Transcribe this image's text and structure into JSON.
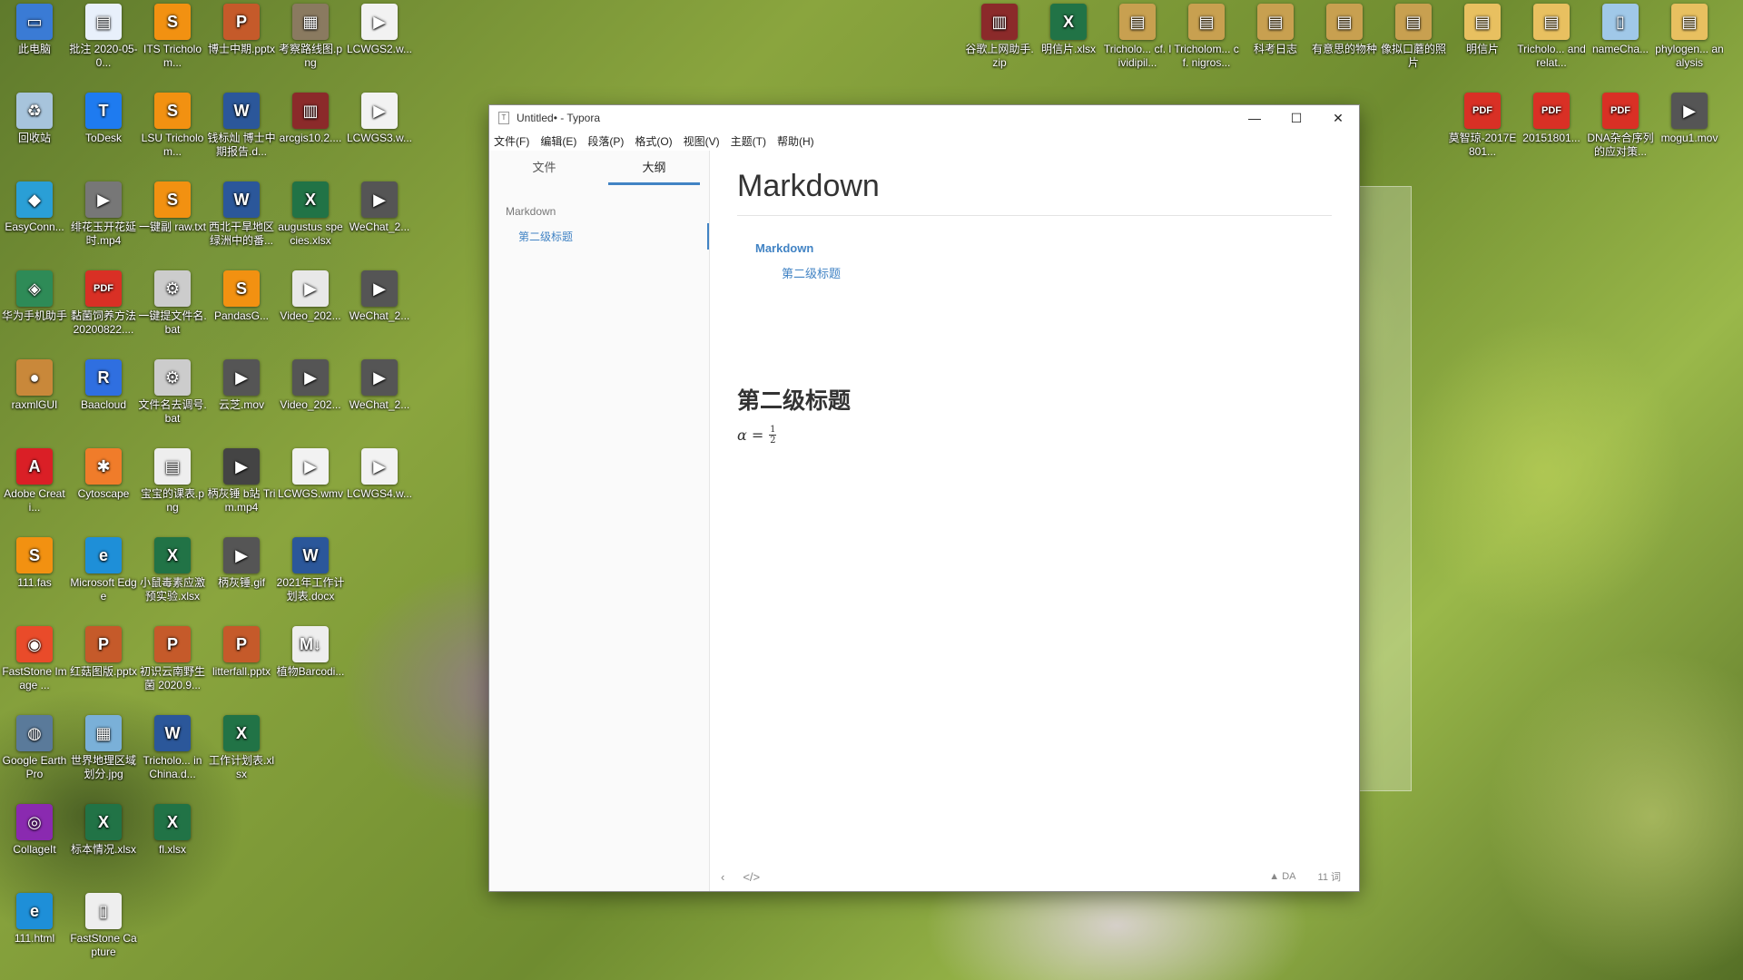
{
  "desktop": {
    "icons": [
      {
        "label": "此电脑",
        "glyph": "▭",
        "color": "#3a7bd5"
      },
      {
        "label": "批注 2020-05-0...",
        "glyph": "▤",
        "color": "#e8f0fb"
      },
      {
        "label": "ITS Tricholom...",
        "glyph": "S",
        "color": "#f29111"
      },
      {
        "label": "博士中期.pptx",
        "glyph": "P",
        "color": "#c55a2a"
      },
      {
        "label": "考察路线图.png",
        "glyph": "▦",
        "color": "#8a7a60"
      },
      {
        "label": "LCWGS2.w...",
        "glyph": "▶",
        "color": "#f2f2f2"
      },
      {
        "label": "回收站",
        "glyph": "♻",
        "color": "#a7c4dc"
      },
      {
        "label": "ToDesk",
        "glyph": "T",
        "color": "#1e7bf0"
      },
      {
        "label": "LSU Tricholom...",
        "glyph": "S",
        "color": "#f29111"
      },
      {
        "label": "钱标灿 博士中期报告.d...",
        "glyph": "W",
        "color": "#2b579a"
      },
      {
        "label": "arcgis10.2....",
        "glyph": "▥",
        "color": "#8b2a2a"
      },
      {
        "label": "LCWGS3.w...",
        "glyph": "▶",
        "color": "#f2f2f2"
      },
      {
        "label": "EasyConn...",
        "glyph": "◆",
        "color": "#2a9fd6"
      },
      {
        "label": "绯花玉开花延时.mp4",
        "glyph": "▶",
        "color": "#777"
      },
      {
        "label": "一键副 raw.txt",
        "glyph": "S",
        "color": "#f29111"
      },
      {
        "label": "西北干旱地区绿洲中的番...",
        "glyph": "W",
        "color": "#2b579a"
      },
      {
        "label": "augustus species.xlsx",
        "glyph": "X",
        "color": "#217346"
      },
      {
        "label": "WeChat_2...",
        "glyph": "▶",
        "color": "#555"
      },
      {
        "label": "华为手机助手",
        "glyph": "◈",
        "color": "#2e8b57"
      },
      {
        "label": "黏菌饲养方法20200822....",
        "glyph": "PDF",
        "color": "#d93025"
      },
      {
        "label": "一键提文件名.bat",
        "glyph": "⚙",
        "color": "#ccc"
      },
      {
        "label": "PandasG...",
        "glyph": "S",
        "color": "#f29111"
      },
      {
        "label": "Video_202...",
        "glyph": "▶",
        "color": "#e8e8e8"
      },
      {
        "label": "WeChat_2...",
        "glyph": "▶",
        "color": "#555"
      },
      {
        "label": "raxmlGUI",
        "glyph": "●",
        "color": "#c9883a"
      },
      {
        "label": "Baacloud",
        "glyph": "R",
        "color": "#2f6fe0"
      },
      {
        "label": "文件名去调号.bat",
        "glyph": "⚙",
        "color": "#ccc"
      },
      {
        "label": "云芝.mov",
        "glyph": "▶",
        "color": "#555"
      },
      {
        "label": "Video_202...",
        "glyph": "▶",
        "color": "#555"
      },
      {
        "label": "WeChat_2...",
        "glyph": "▶",
        "color": "#555"
      },
      {
        "label": "Adobe Creati...",
        "glyph": "A",
        "color": "#da1f26"
      },
      {
        "label": "Cytoscape",
        "glyph": "✱",
        "color": "#f07c2a"
      },
      {
        "label": "宝宝的课表.png",
        "glyph": "▤",
        "color": "#eee"
      },
      {
        "label": "柄灰锤 b站 Trim.mp4",
        "glyph": "▶",
        "color": "#444"
      },
      {
        "label": "LCWGS.wmv",
        "glyph": "▶",
        "color": "#f2f2f2"
      },
      {
        "label": "LCWGS4.w...",
        "glyph": "▶",
        "color": "#f2f2f2"
      },
      {
        "label": "111.fas",
        "glyph": "S",
        "color": "#f29111"
      },
      {
        "label": "Microsoft Edge",
        "glyph": "e",
        "color": "#1e8fd8"
      },
      {
        "label": "小鼠毒素应激预实验.xlsx",
        "glyph": "X",
        "color": "#217346"
      },
      {
        "label": "柄灰锤.gif",
        "glyph": "▶",
        "color": "#555"
      },
      {
        "label": "2021年工作计划表.docx",
        "glyph": "W",
        "color": "#2b579a"
      },
      {
        "label": "FastStone Image ...",
        "glyph": "◉",
        "color": "#e94b2a"
      },
      {
        "label": "红菇图版.pptx",
        "glyph": "P",
        "color": "#c55a2a"
      },
      {
        "label": "初识云南野生菌 2020.9...",
        "glyph": "P",
        "color": "#c55a2a"
      },
      {
        "label": "litterfall.pptx",
        "glyph": "P",
        "color": "#c55a2a"
      },
      {
        "label": "植物Barcodi...",
        "glyph": "M↓",
        "color": "#eee"
      },
      {
        "label": "Google Earth Pro",
        "glyph": "◍",
        "color": "#5a7a9a"
      },
      {
        "label": "世界地理区域划分.jpg",
        "glyph": "▦",
        "color": "#7ab0d8"
      },
      {
        "label": "Tricholo... in China.d...",
        "glyph": "W",
        "color": "#2b579a"
      },
      {
        "label": "工作计划表.xlsx",
        "glyph": "X",
        "color": "#217346"
      },
      {
        "label": "CollageIt",
        "glyph": "◎",
        "color": "#8a2ab0"
      },
      {
        "label": "标本情况.xlsx",
        "glyph": "X",
        "color": "#217346"
      },
      {
        "label": "fl.xlsx",
        "glyph": "X",
        "color": "#217346"
      },
      {
        "label": "111.html",
        "glyph": "e",
        "color": "#1e8fd8"
      },
      {
        "label": "FastStone Capture",
        "glyph": "▯",
        "color": "#eee"
      }
    ],
    "right_icons": [
      {
        "label": "谷歌上网助手.zip",
        "glyph": "▥",
        "color": "#8b2a2a"
      },
      {
        "label": "明信片.xlsx",
        "glyph": "X",
        "color": "#217346"
      },
      {
        "label": "Tricholo... cf. lividipil...",
        "glyph": "▤",
        "color": "#c8a050"
      },
      {
        "label": "Tricholom... cf. nigros...",
        "glyph": "▤",
        "color": "#c8a050"
      },
      {
        "label": "科考日志",
        "glyph": "▤",
        "color": "#c8a050"
      },
      {
        "label": "有意思的物种",
        "glyph": "▤",
        "color": "#c8a050"
      },
      {
        "label": "像拟口蘑的照片",
        "glyph": "▤",
        "color": "#c8a050"
      },
      {
        "label": "明信片",
        "glyph": "▤",
        "color": "#e8c060"
      },
      {
        "label": "Tricholo... and relat...",
        "glyph": "▤",
        "color": "#e8c060"
      },
      {
        "label": "nameCha...",
        "glyph": "▯",
        "color": "#a0c8e8"
      },
      {
        "label": "phylogen... analysis",
        "glyph": "▤",
        "color": "#e8c060"
      },
      {
        "label": "莫智琼-2017E801...",
        "glyph": "PDF",
        "color": "#d93025"
      },
      {
        "label": "20151801...",
        "glyph": "PDF",
        "color": "#d93025"
      },
      {
        "label": "DNA杂合序列的应对策...",
        "glyph": "PDF",
        "color": "#d93025"
      },
      {
        "label": "mogu1.mov",
        "glyph": "▶",
        "color": "#555"
      }
    ]
  },
  "window": {
    "title": "Untitled• - Typora",
    "logo": "T",
    "controls": {
      "minimize": "—",
      "maximize": "☐",
      "close": "✕"
    },
    "menu": [
      "文件(F)",
      "编辑(E)",
      "段落(P)",
      "格式(O)",
      "视图(V)",
      "主题(T)",
      "帮助(H)"
    ]
  },
  "sidebar": {
    "tabs": [
      "文件",
      "大纲"
    ],
    "active_tab": "大纲",
    "outline": [
      {
        "level": 1,
        "text": "Markdown"
      },
      {
        "level": 2,
        "text": "第二级标题",
        "active": true
      }
    ]
  },
  "editor": {
    "h1": "Markdown",
    "toc": [
      {
        "level": 1,
        "text": "Markdown"
      },
      {
        "level": 2,
        "text": "第二级标题"
      }
    ],
    "h2": "第二级标题",
    "math": {
      "lhs": "α = ",
      "num": "1",
      "den": "2"
    }
  },
  "statusbar": {
    "left_icons": [
      "‹",
      "</>"
    ],
    "lang": "▲ DA",
    "word_count": "11 词"
  }
}
